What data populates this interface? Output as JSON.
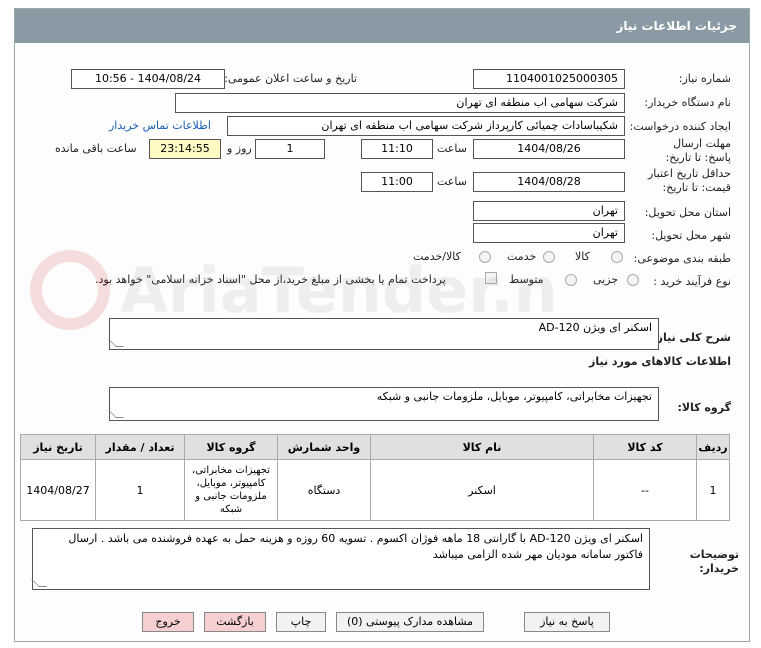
{
  "header": {
    "title": "جزئیات اطلاعات نیاز"
  },
  "labels": {
    "need_number": "شماره نیاز:",
    "announce_datetime": "تاریخ و ساعت اعلان عمومی:",
    "buyer_org": "نام دستگاه خریدار:",
    "requester": "ایجاد کننده درخواست:",
    "reply_deadline": "مهلت ارسال پاسخ: تا تاریخ:",
    "hour1": "ساعت",
    "day_and": "روز و",
    "remaining": "ساعت باقی مانده",
    "price_validity": "حداقل تاریخ اعتبار قیمت: تا تاریخ:",
    "hour2": "ساعت",
    "province": "استان محل تحویل:",
    "city": "شهر محل تحویل:",
    "category": "طبقه بندی موضوعی:",
    "purchase_type": "نوع فرآیند خرید :",
    "summary": "شرح کلی نیاز:",
    "goods_info": "اطلاعات کالاهای مورد نیاز",
    "goods_group": "گروه کالا:",
    "buyer_notes": "توضیحات خریدار:"
  },
  "values": {
    "need_number": "1104001025000305",
    "announce_datetime": "1404/08/24 - 10:56",
    "buyer_org": "شرکت سهامی اب منطقه ای تهران",
    "requester": "شکیباسادات چمیائی کارپرداز شرکت سهامی اب منطقه ای تهران",
    "contact_link": "اطلاعات تماس خریدار",
    "reply_date": "1404/08/26",
    "reply_hour": "11:10",
    "days": "1",
    "remaining_time": "23:14:55",
    "validity_date": "1404/08/28",
    "validity_hour": "11:00",
    "province": "تهران",
    "city": "تهران",
    "summary": "اسکنر ای ویژن  AD-120",
    "goods_group": "تجهیزات مخابراتی، کامپیوتر، موبایل، ملزومات جانبی و شبکه",
    "buyer_notes": "اسکنر ای ویژن  AD-120 با گارانتی 18 ماهه فوژان اکسوم . تسویه 60 روزه و هزینه حمل به عهده فروشنده می باشد . ارسال فاکتور سامانه مودیان مهر شده الزامی میباشد"
  },
  "category_options": [
    "کالا",
    "خدمت",
    "کالا/خدمت"
  ],
  "purchase_options": [
    "جزیی",
    "متوسط"
  ],
  "treasury_note": "پرداخت تمام یا بخشی از مبلغ خرید،از محل \"اسناد خزانه اسلامی\" خواهد بود.",
  "table": {
    "headers": [
      "ردیف",
      "کد کالا",
      "نام کالا",
      "واحد شمارش",
      "گروه کالا",
      "تعداد / مقدار",
      "تاریخ نیاز"
    ],
    "rows": [
      [
        "1",
        "--",
        "اسکنر",
        "دستگاه",
        "تجهیزات مخابراتی، کامپیوتر، موبایل، ملزومات جانبی و شبکه",
        "1",
        "1404/08/27"
      ]
    ]
  },
  "buttons": {
    "reply": "پاسخ به نیاز",
    "attachments": "مشاهده مدارک پیوستی (0)",
    "print": "چاپ",
    "back": "بازگشت",
    "exit": "خروج"
  },
  "watermark": "AriaTender.net"
}
